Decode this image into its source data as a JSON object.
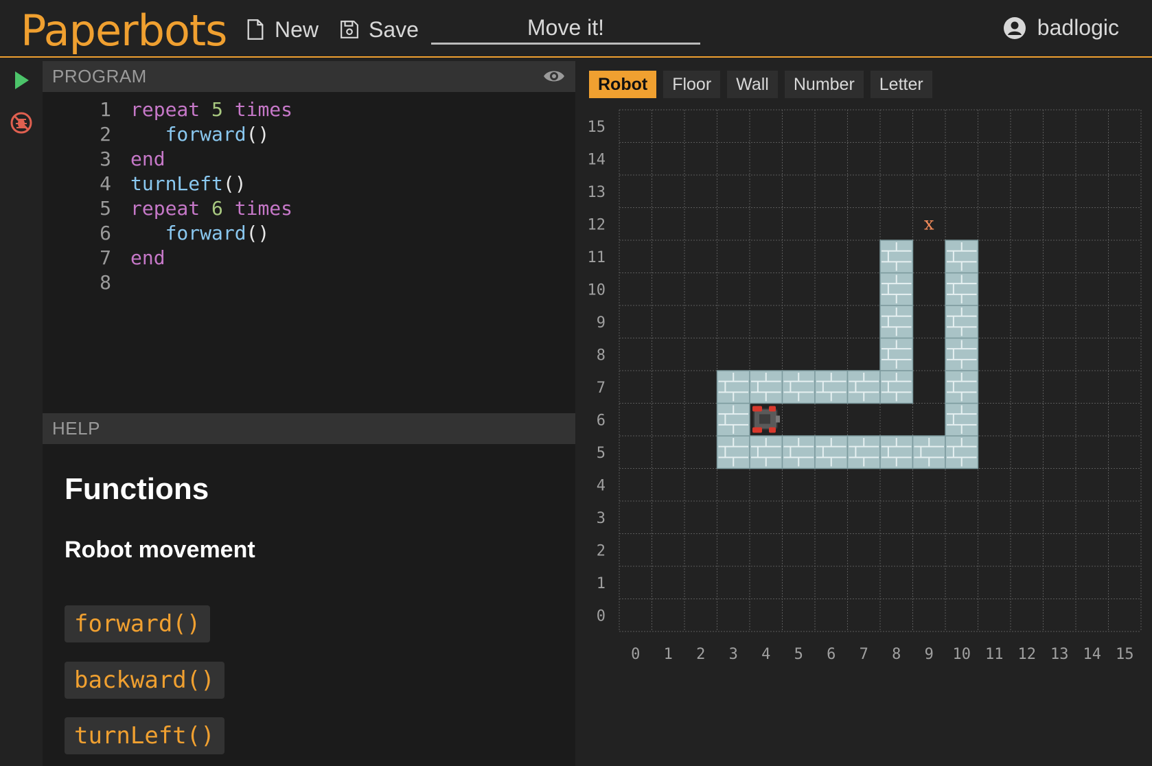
{
  "header": {
    "logo": "Paperbots",
    "new_label": "New",
    "save_label": "Save",
    "title_value": "Move it!",
    "username": "badlogic"
  },
  "program": {
    "heading": "PROGRAM",
    "lines": [
      {
        "n": "1",
        "tokens": [
          {
            "t": "repeat ",
            "c": "kw"
          },
          {
            "t": "5",
            "c": "num"
          },
          {
            "t": " times",
            "c": "kw"
          }
        ]
      },
      {
        "n": "2",
        "tokens": [
          {
            "t": "   ",
            "c": "pn"
          },
          {
            "t": "forward",
            "c": "fn"
          },
          {
            "t": "()",
            "c": "pn"
          }
        ]
      },
      {
        "n": "3",
        "tokens": [
          {
            "t": "end",
            "c": "kw"
          }
        ]
      },
      {
        "n": "4",
        "tokens": [
          {
            "t": "turnLeft",
            "c": "fn"
          },
          {
            "t": "()",
            "c": "pn"
          }
        ]
      },
      {
        "n": "5",
        "tokens": [
          {
            "t": "repeat ",
            "c": "kw"
          },
          {
            "t": "6",
            "c": "num"
          },
          {
            "t": " times",
            "c": "kw"
          }
        ]
      },
      {
        "n": "6",
        "tokens": [
          {
            "t": "   ",
            "c": "pn"
          },
          {
            "t": "forward",
            "c": "fn"
          },
          {
            "t": "()",
            "c": "pn"
          }
        ]
      },
      {
        "n": "7",
        "tokens": [
          {
            "t": "end",
            "c": "kw"
          }
        ]
      },
      {
        "n": "8",
        "tokens": []
      }
    ]
  },
  "help": {
    "heading": "HELP",
    "title": "Functions",
    "subtitle": "Robot movement",
    "functions": [
      "forward()",
      "backward()",
      "turnLeft()"
    ]
  },
  "world": {
    "tabs": [
      "Robot",
      "Floor",
      "Wall",
      "Number",
      "Letter"
    ],
    "active_tab": "Robot",
    "axis_x": [
      "0",
      "1",
      "2",
      "3",
      "4",
      "5",
      "6",
      "7",
      "8",
      "9",
      "10",
      "11",
      "12",
      "13",
      "14",
      "15"
    ],
    "axis_y": [
      "0",
      "1",
      "2",
      "3",
      "4",
      "5",
      "6",
      "7",
      "8",
      "9",
      "10",
      "11",
      "12",
      "13",
      "14",
      "15"
    ],
    "walls": [
      [
        3,
        5
      ],
      [
        4,
        5
      ],
      [
        5,
        5
      ],
      [
        6,
        5
      ],
      [
        7,
        5
      ],
      [
        8,
        5
      ],
      [
        9,
        5
      ],
      [
        10,
        5
      ],
      [
        3,
        6
      ],
      [
        10,
        6
      ],
      [
        3,
        7
      ],
      [
        4,
        7
      ],
      [
        5,
        7
      ],
      [
        6,
        7
      ],
      [
        7,
        7
      ],
      [
        8,
        7
      ],
      [
        10,
        7
      ],
      [
        8,
        8
      ],
      [
        10,
        8
      ],
      [
        8,
        9
      ],
      [
        10,
        9
      ],
      [
        8,
        10
      ],
      [
        10,
        10
      ],
      [
        8,
        11
      ],
      [
        10,
        11
      ]
    ],
    "robot": {
      "x": 4,
      "y": 6,
      "direction": "right"
    },
    "goal": {
      "x": 9,
      "y": 12,
      "letter": "x"
    }
  },
  "colors": {
    "accent": "#f0a030",
    "run": "#4cc46a",
    "debug": "#e06050",
    "wall": "#a9c3c6",
    "goal": "#f08a5a"
  }
}
